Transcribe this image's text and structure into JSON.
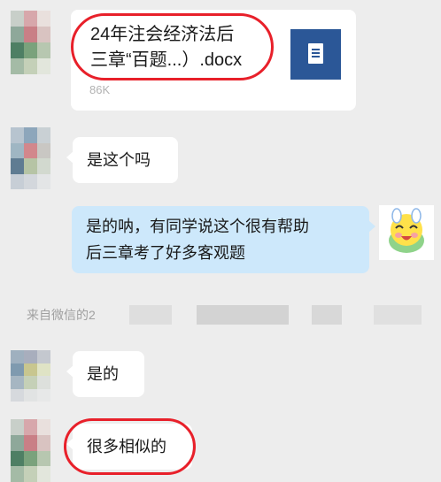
{
  "messages": [
    {
      "type": "file",
      "file": {
        "name_line1": "24年注会经济法后",
        "name_line2": "三章“百题...）.docx",
        "size": "86K",
        "icon": "word-document-icon"
      }
    },
    {
      "type": "text",
      "side": "left",
      "text": "是这个吗"
    },
    {
      "type": "text",
      "side": "right",
      "line1": "是的呐，有同学说这个很有帮助",
      "line2": "后三章考了好多客观题"
    },
    {
      "type": "text",
      "side": "left",
      "text": "是的"
    },
    {
      "type": "text",
      "side": "left",
      "text": "很多相似的"
    }
  ],
  "system": {
    "source_text": "来自微信的2"
  },
  "colors": {
    "background": "#ededed",
    "bubble_left": "#ffffff",
    "bubble_right": "#cde8fb",
    "highlight": "#e8202a",
    "word_icon": "#2b5797"
  }
}
